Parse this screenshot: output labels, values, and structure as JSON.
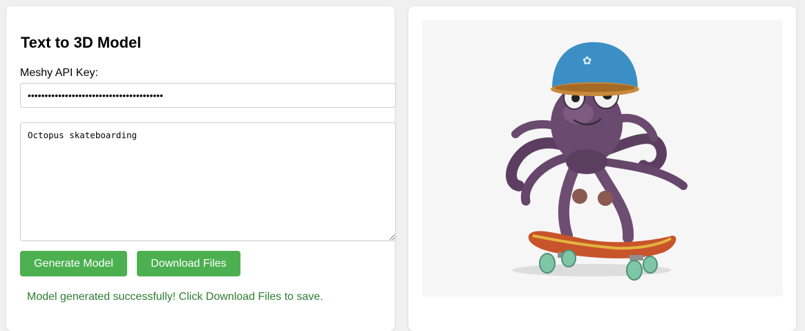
{
  "form": {
    "title": "Text to 3D Model",
    "api_key_label": "Meshy API Key:",
    "api_key_value": "••••••••••••••••••••••••••••••••••••••••",
    "prompt_value": "Octopus skateboarding",
    "generate_label": "Generate Model",
    "download_label": "Download Files",
    "status_message": "Model generated successfully! Click Download Files to save.",
    "status_color": "#2e7d32"
  },
  "viewer": {
    "model_subject": "octopus-on-skateboard",
    "colors": {
      "background": "#f6f6f6",
      "helmet": "#3b8fc4",
      "body": "#6a4a6e",
      "board_deck": "#c8542b",
      "wheels": "#7fc6a6"
    }
  },
  "theme": {
    "button_color": "#4caf50",
    "button_text_color": "#ffffff"
  }
}
